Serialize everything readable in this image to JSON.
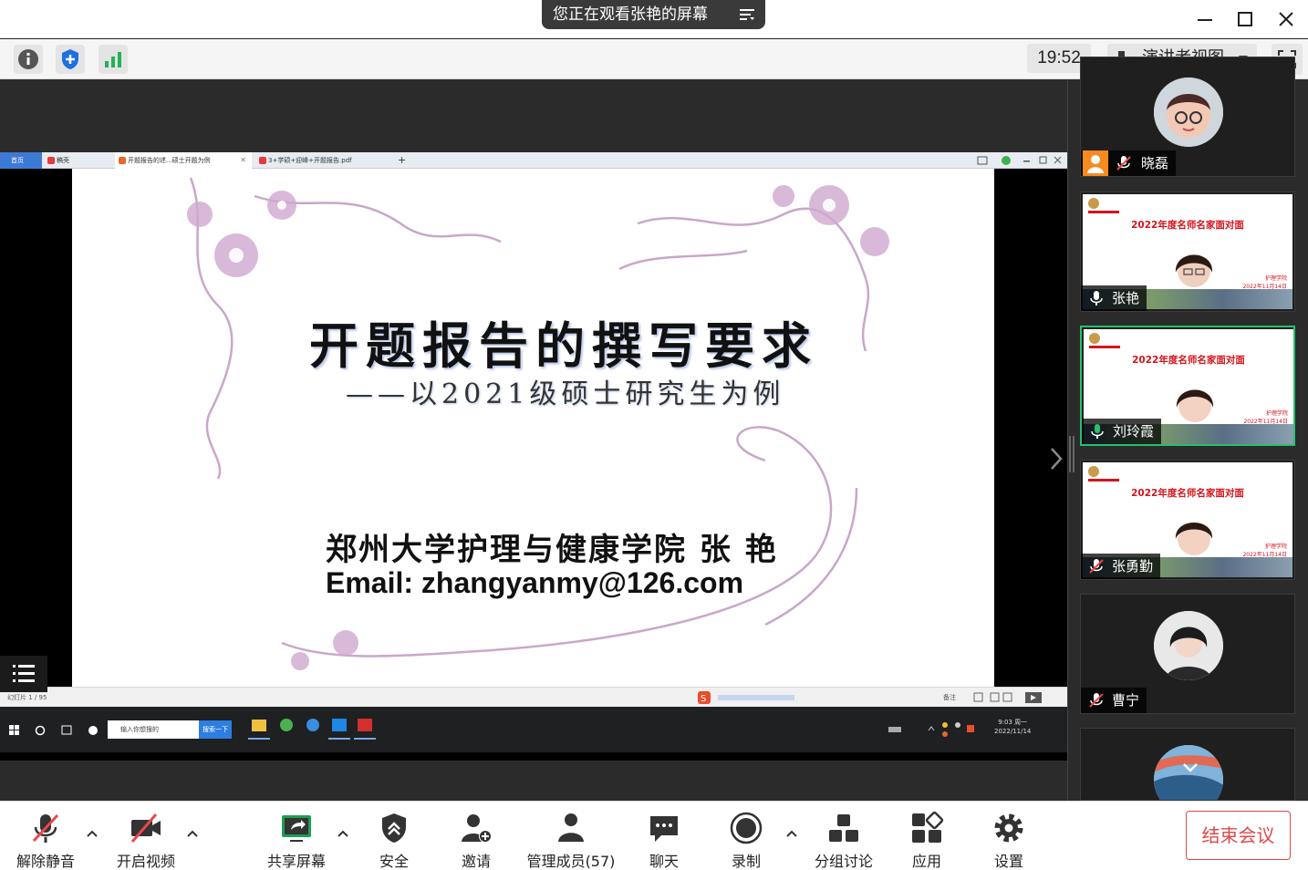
{
  "titlebar": {
    "viewing_label": "您正在观看张艳的屏幕"
  },
  "toprow": {
    "clock": "19:52",
    "view_mode": "演讲者视图"
  },
  "shared_browser": {
    "tabs": [
      {
        "label": "首页"
      },
      {
        "label": "稿壳"
      },
      {
        "label": "开题报告的述...硕士开题为例"
      },
      {
        "label": "3+学硕+迎峰+开题报告.pdf"
      }
    ],
    "new_tab": "+"
  },
  "slide": {
    "title": "开题报告的撰写要求",
    "subtitle": "——以2021级硕士研究生为例",
    "author": "郑州大学护理与健康学院  张  艳",
    "email": "Email: zhangyanmy@126.com"
  },
  "wps_status": {
    "slide_counter": "幻灯片 1 / 95",
    "notes": "备注"
  },
  "win_taskbar": {
    "search_placeholder": "输入你想搜的",
    "search_button": "搜索一下",
    "time": "9:03 周一",
    "date": "2022/11/14"
  },
  "participants": [
    {
      "name": "晓磊",
      "type": "avatar"
    },
    {
      "name": "张艳",
      "type": "feed"
    },
    {
      "name": "刘玲霞",
      "type": "feed",
      "speaking": true
    },
    {
      "name": "张勇勤",
      "type": "feed"
    },
    {
      "name": "曹宁",
      "type": "avatar"
    },
    {
      "name": "",
      "type": "avatar"
    }
  ],
  "feed_overlay": {
    "title": "2022年度名师名家面对面",
    "side_line1": "护理学院",
    "side_line2": "2022年11月14日"
  },
  "bottombar": {
    "unmute": "解除静音",
    "start_video": "开启视频",
    "share_screen": "共享屏幕",
    "security": "安全",
    "invite": "邀请",
    "manage_members": "管理成员(57)",
    "chat": "聊天",
    "record": "录制",
    "breakout": "分组讨论",
    "apps": "应用",
    "settings": "设置",
    "end_meeting": "结束会议"
  },
  "colors": {
    "accent_green": "#25c26b",
    "end_red": "#e04848",
    "feed_red": "#d4151c"
  }
}
